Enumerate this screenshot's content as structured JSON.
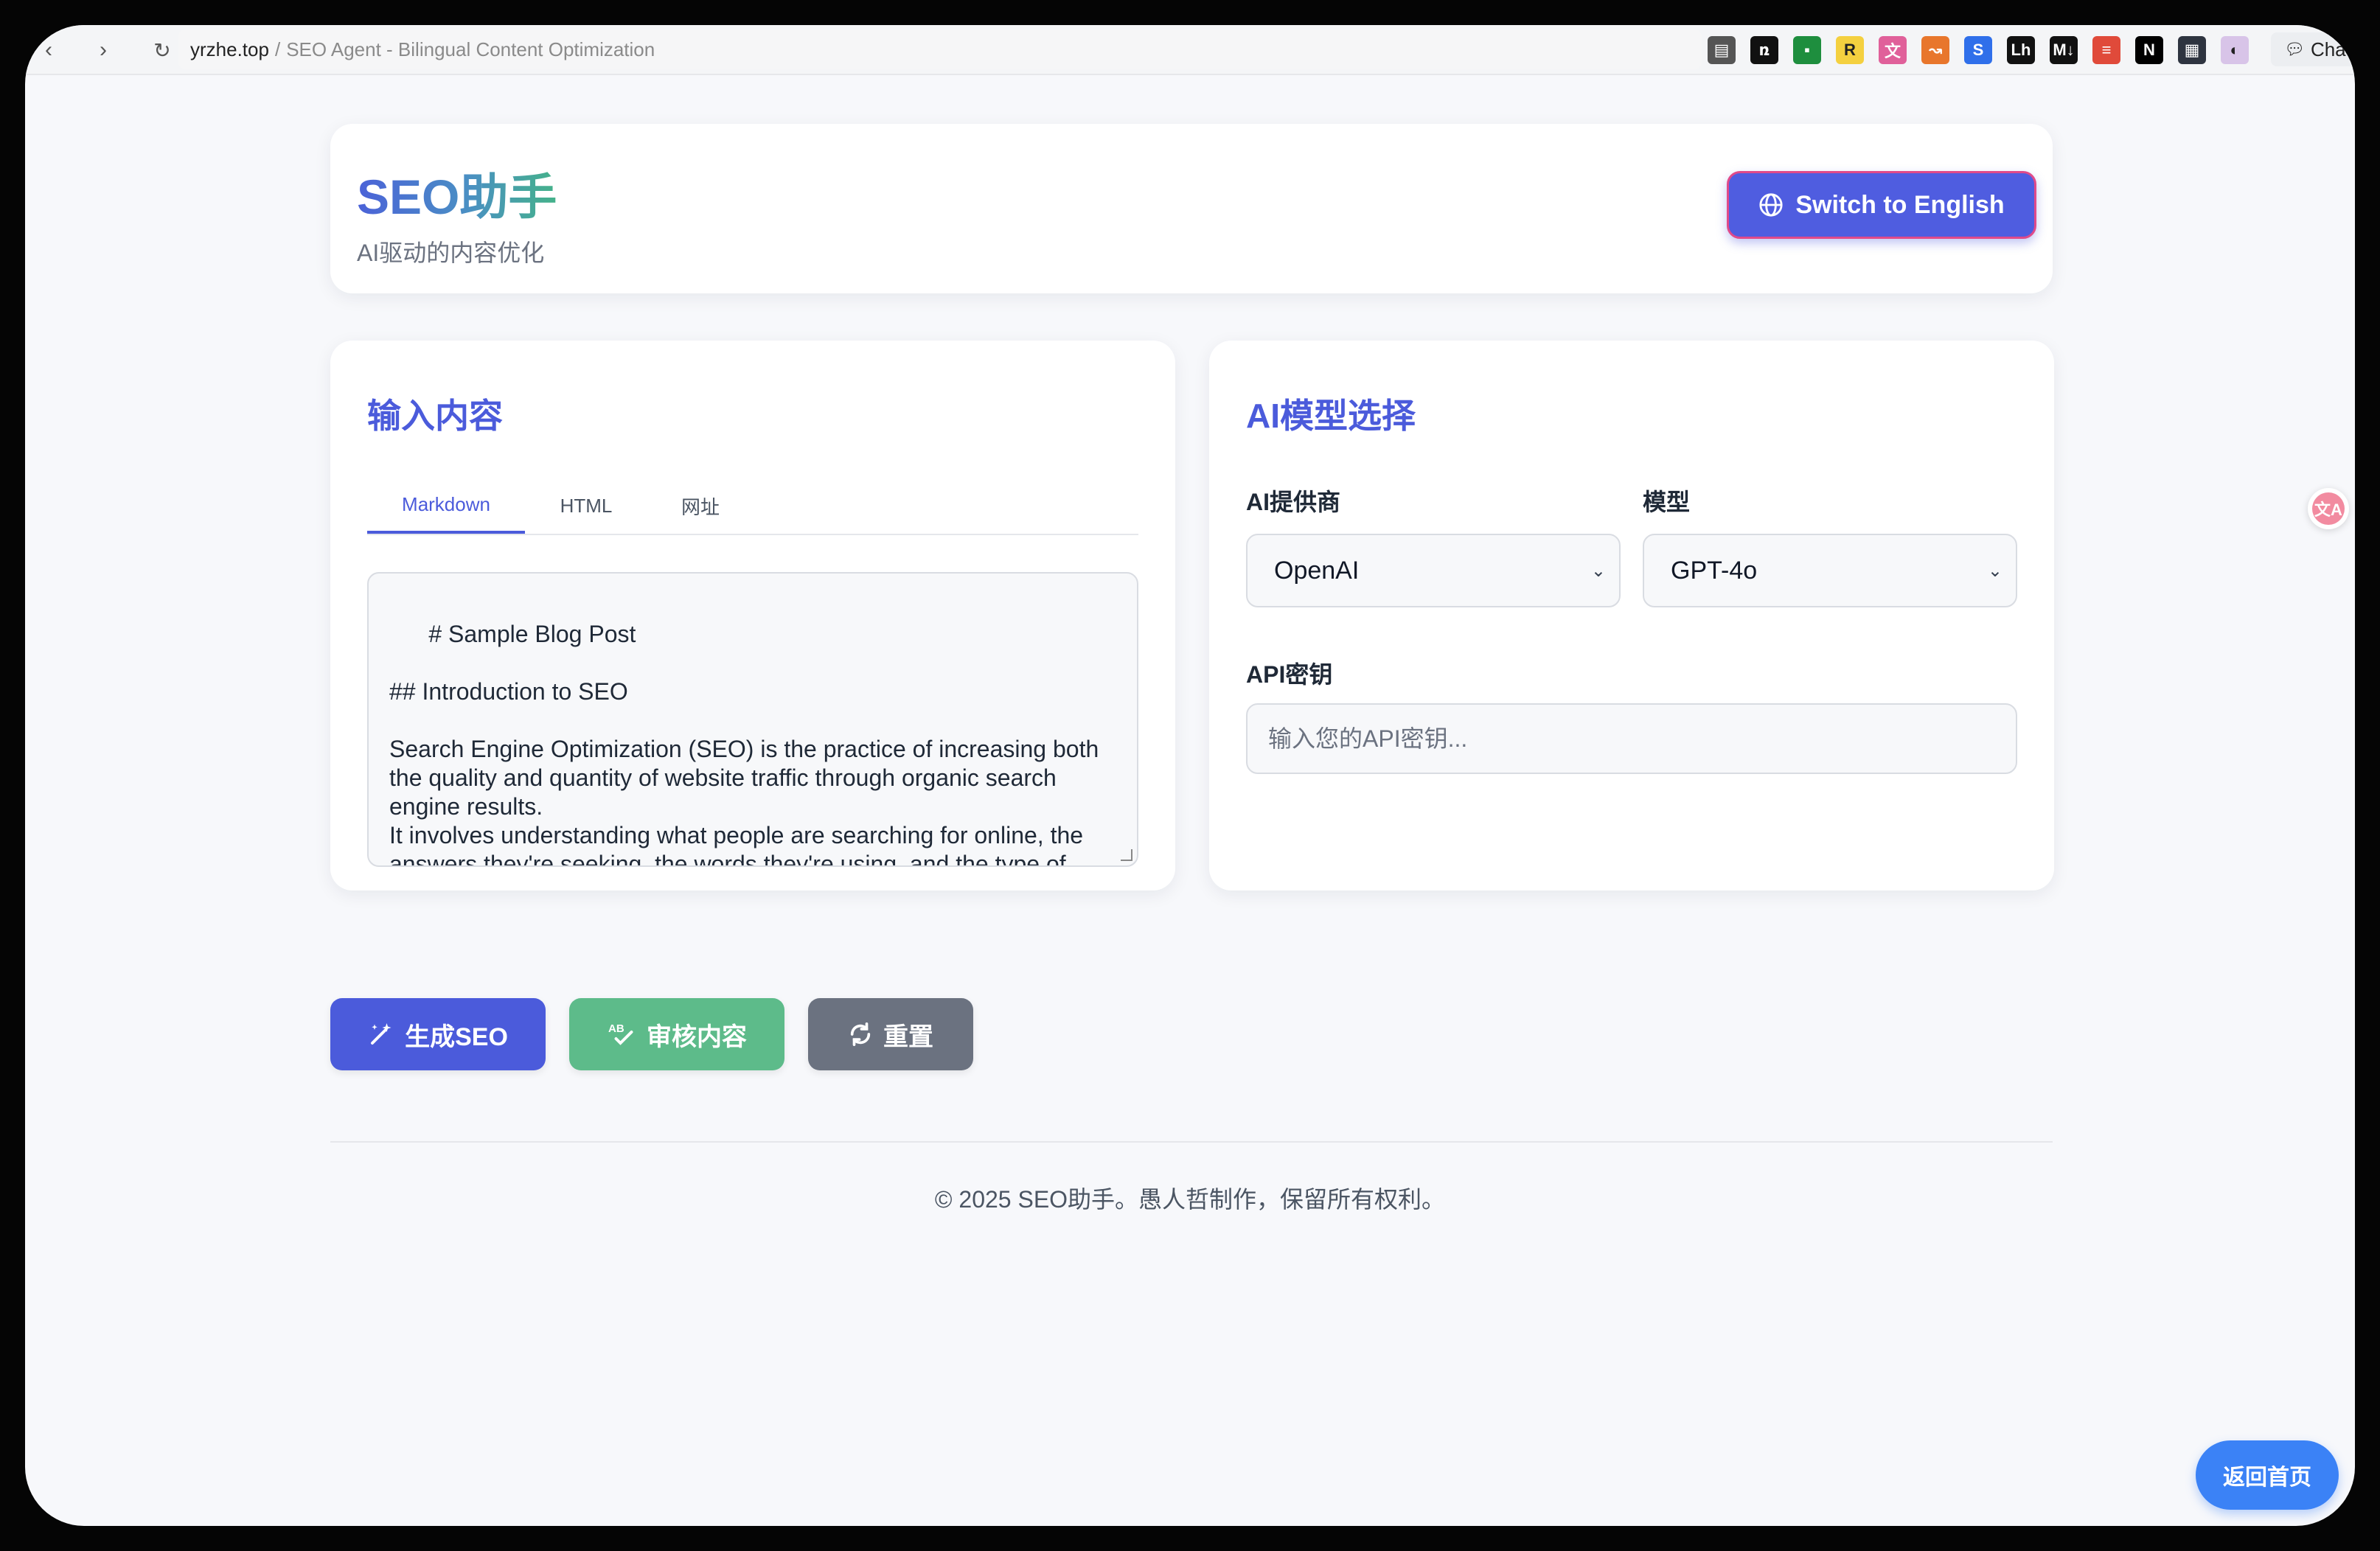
{
  "browser": {
    "domain": "yrzhe.top",
    "separator": "/",
    "page_title": "SEO Agent - Bilingual Content Optimization",
    "chat_label": "Chat",
    "extensions": [
      {
        "icon": "reader-icon",
        "glyph": "▤",
        "color": "#555555"
      },
      {
        "icon": "n-logo-icon",
        "glyph": "ռ",
        "color": "#111111"
      },
      {
        "icon": "sheet-icon",
        "glyph": "▪",
        "color": "#1e8e3e"
      },
      {
        "icon": "r-icon",
        "glyph": "R",
        "color": "#f4d03f"
      },
      {
        "icon": "translate-icon",
        "glyph": "文",
        "color": "#e0609a"
      },
      {
        "icon": "link-icon",
        "glyph": "↝",
        "color": "#e8762c"
      },
      {
        "icon": "s-icon",
        "glyph": "S",
        "color": "#2f6fea"
      },
      {
        "icon": "lh-icon",
        "glyph": "Lh",
        "color": "#111111"
      },
      {
        "icon": "markdown-icon",
        "glyph": "M↓",
        "color": "#111111"
      },
      {
        "icon": "list-icon",
        "glyph": "≡",
        "color": "#e04a3a"
      },
      {
        "icon": "notion-icon",
        "glyph": "N",
        "color": "#000000"
      },
      {
        "icon": "code-icon",
        "glyph": "▦",
        "color": "#2e3440"
      },
      {
        "icon": "gradient-icon",
        "glyph": "◐",
        "color": "#d8c4e8"
      }
    ]
  },
  "header": {
    "brand": "SEO助手",
    "subtitle": "AI驱动的内容优化",
    "switch_label": "Switch to English"
  },
  "input_card": {
    "title": "输入内容",
    "tabs": [
      {
        "label": "Markdown",
        "active": true
      },
      {
        "label": "HTML",
        "active": false
      },
      {
        "label": "网址",
        "active": false
      }
    ],
    "content": "# Sample Blog Post\n\n## Introduction to SEO\n\nSearch Engine Optimization (SEO) is the practice of increasing both the quality and quantity of website traffic through organic search engine results.\nIt involves understanding what people are searching for online, the answers they're seeking, the words they're using, and the type of content they wish to consume."
  },
  "model_card": {
    "title": "AI模型选择",
    "provider_label": "AI提供商",
    "provider_value": "OpenAI",
    "model_label": "模型",
    "model_value": "GPT-4o",
    "api_label": "API密钥",
    "api_placeholder": "输入您的API密钥..."
  },
  "actions": {
    "generate": {
      "label": "生成SEO",
      "color": "#4b5bdb"
    },
    "review": {
      "label": "审核内容",
      "color": "#5dbb8a"
    },
    "reset": {
      "label": "重置",
      "color": "#6b7280"
    }
  },
  "footer": {
    "text": "© 2025 SEO助手。愚人哲制作，保留所有权利。"
  },
  "floating": {
    "home_label": "返回首页",
    "translate_glyph": "文A"
  }
}
